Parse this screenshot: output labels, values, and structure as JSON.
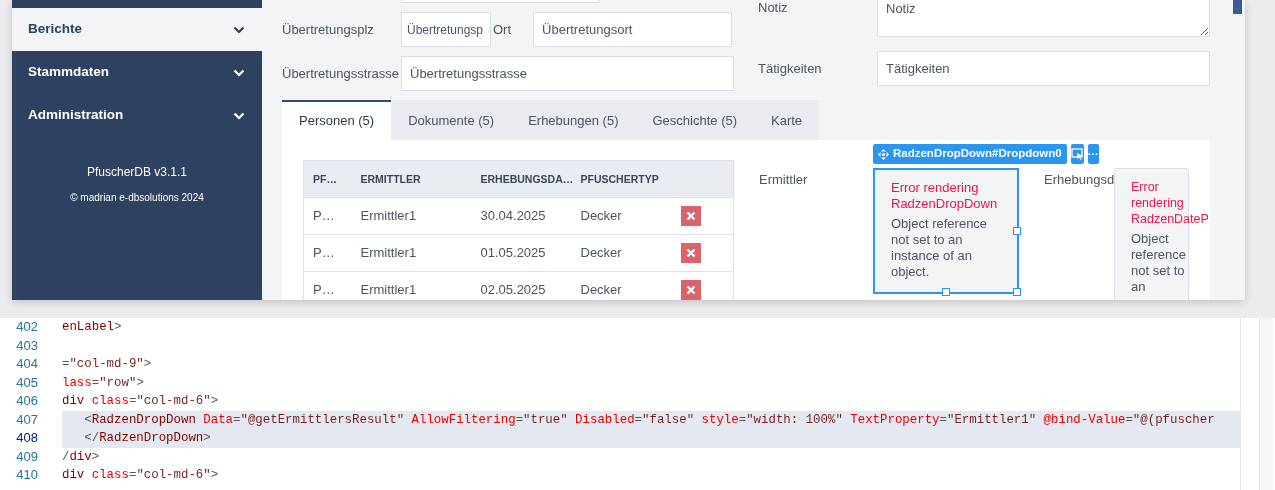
{
  "sidebar": {
    "items": [
      {
        "label": "Berichte",
        "selected": true
      },
      {
        "label": "Stammdaten",
        "selected": false
      },
      {
        "label": "Administration",
        "selected": false
      }
    ],
    "version": "PfuscherDB v3.1.1",
    "copyright": "© madrian e-dbsolutions 2024"
  },
  "form": {
    "notiz": {
      "label": "Notiz",
      "placeholder": "Notiz"
    },
    "plz": {
      "label": "Übertretungsplz",
      "placeholder": "Übertretungsp"
    },
    "ort": {
      "label": "Ort",
      "placeholder": "Übertretungsort"
    },
    "strasse": {
      "label": "Übertretungsstrasse",
      "placeholder": "Übertretungsstrasse"
    },
    "taetigkeiten": {
      "label": "Tätigkeiten",
      "placeholder": "Tätigkeiten"
    }
  },
  "tabs": [
    {
      "label": "Personen (5)",
      "selected": true
    },
    {
      "label": "Dokumente (5)",
      "selected": false
    },
    {
      "label": "Erhebungen (5)",
      "selected": false
    },
    {
      "label": "Geschichte (5)",
      "selected": false
    },
    {
      "label": "Karte",
      "selected": false
    }
  ],
  "grid": {
    "columns": [
      "PF…",
      "ERMITTLER",
      "ERHEBUNGSDA…",
      "PFUSCHERTYP"
    ],
    "rows": [
      {
        "cells": [
          "P…",
          "Ermittler1",
          "30.04.2025",
          "Decker"
        ]
      },
      {
        "cells": [
          "P…",
          "Ermittler1",
          "01.05.2025",
          "Decker"
        ]
      },
      {
        "cells": [
          "P…",
          "Ermittler1",
          "02.05.2025",
          "Decker"
        ]
      }
    ]
  },
  "designer": {
    "badge": "RadzenDropDown#Dropdown0",
    "more": "···",
    "labels": [
      "Ermittler",
      "Erhebungsd"
    ],
    "error_boxes": [
      {
        "title": "Error rendering RadzenDropDown",
        "message": "Object reference not set to an instance of an object.",
        "selected": true
      },
      {
        "title": "Error rendering RadzenDateP",
        "message": "Object reference not set to an",
        "selected": false
      }
    ]
  },
  "editor": {
    "lines": [
      {
        "number": "402",
        "current": false,
        "selected": false,
        "tokens": [
          {
            "kind": "tag",
            "text": "enLabel"
          },
          {
            "kind": "delim",
            "text": ">"
          }
        ]
      },
      {
        "number": "403",
        "current": false,
        "selected": false
      },
      {
        "number": "404",
        "current": false,
        "selected": false,
        "tokens": [
          {
            "kind": "delim",
            "text": "="
          },
          {
            "kind": "str",
            "text": "\"col-md-9\""
          },
          {
            "kind": "delim",
            "text": ">"
          }
        ]
      },
      {
        "number": "405",
        "current": false,
        "selected": false,
        "tokens": [
          {
            "kind": "attr",
            "text": "lass"
          },
          {
            "kind": "delim",
            "text": "="
          },
          {
            "kind": "str",
            "text": "\"row\""
          },
          {
            "kind": "delim",
            "text": ">"
          }
        ]
      },
      {
        "number": "406",
        "current": false,
        "selected": false,
        "tokens": [
          {
            "kind": "tag",
            "text": "div"
          },
          {
            "kind": "attr",
            "text": " class"
          },
          {
            "kind": "delim",
            "text": "="
          },
          {
            "kind": "str",
            "text": "\"col-md-6\""
          },
          {
            "kind": "delim",
            "text": ">"
          }
        ]
      },
      {
        "number": "407",
        "current": false,
        "selected": true,
        "tokens": [
          {
            "kind": "delim",
            "text": "   <"
          },
          {
            "kind": "tag",
            "text": "RadzenDropDown"
          },
          {
            "kind": "attr",
            "text": " Data"
          },
          {
            "kind": "delim",
            "text": "="
          },
          {
            "kind": "str",
            "text": "\"@getErmittlersResult\""
          },
          {
            "kind": "attr",
            "text": " AllowFiltering"
          },
          {
            "kind": "delim",
            "text": "="
          },
          {
            "kind": "str",
            "text": "\"true\""
          },
          {
            "kind": "attr",
            "text": " Disabled"
          },
          {
            "kind": "delim",
            "text": "="
          },
          {
            "kind": "str",
            "text": "\"false\""
          },
          {
            "kind": "attr",
            "text": " style"
          },
          {
            "kind": "delim",
            "text": "="
          },
          {
            "kind": "str",
            "text": "\"width: 100%\""
          },
          {
            "kind": "attr",
            "text": " TextProperty"
          },
          {
            "kind": "delim",
            "text": "="
          },
          {
            "kind": "str",
            "text": "\"Ermittler1\""
          },
          {
            "kind": "attr",
            "text": " @bind-Value"
          },
          {
            "kind": "delim",
            "text": "="
          },
          {
            "kind": "str",
            "text": "\"@(pfuscher"
          }
        ]
      },
      {
        "number": "408",
        "current": true,
        "selected": true,
        "tokens": [
          {
            "kind": "delim",
            "text": "   </"
          },
          {
            "kind": "tag",
            "text": "RadzenDropDown"
          },
          {
            "kind": "delim",
            "text": ">"
          }
        ]
      },
      {
        "number": "409",
        "current": false,
        "selected": false,
        "tokens": [
          {
            "kind": "delim",
            "text": "/"
          },
          {
            "kind": "tag",
            "text": "div"
          },
          {
            "kind": "delim",
            "text": ">"
          }
        ]
      },
      {
        "number": "410",
        "current": false,
        "selected": false,
        "tokens": [
          {
            "kind": "tag",
            "text": "div"
          },
          {
            "kind": "attr",
            "text": " class"
          },
          {
            "kind": "delim",
            "text": "="
          },
          {
            "kind": "str",
            "text": "\"col-md-6\""
          },
          {
            "kind": "delim",
            "text": ">"
          }
        ]
      }
    ]
  }
}
